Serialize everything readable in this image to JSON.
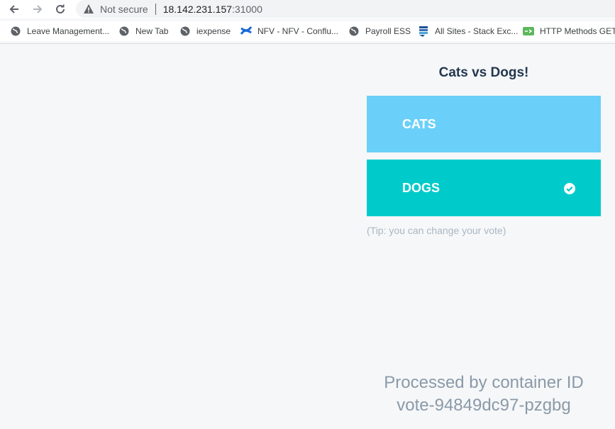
{
  "browser": {
    "security_label": "Not secure",
    "url_host": "18.142.231.157",
    "url_port": ":31000",
    "bookmarks": [
      {
        "label": "Leave Management...",
        "icon": "globe-icon"
      },
      {
        "label": "New Tab",
        "icon": "globe-icon"
      },
      {
        "label": "iexpense",
        "icon": "globe-icon"
      },
      {
        "label": "NFV - NFV - Conflu...",
        "icon": "confluence-icon"
      },
      {
        "label": "Payroll ESS",
        "icon": "globe-icon"
      },
      {
        "label": "All Sites - Stack Exc...",
        "icon": "stackexchange-icon"
      },
      {
        "label": "HTTP Methods GET...",
        "icon": "httpmethods-icon"
      }
    ]
  },
  "page": {
    "title": "Cats vs Dogs!",
    "options": [
      {
        "label": "CATS",
        "selected": false,
        "color": "#6ad0f9"
      },
      {
        "label": "DOGS",
        "selected": true,
        "color": "#00cbca"
      }
    ],
    "tip": "(Tip: you can change your vote)",
    "processed_by": "Processed by container ID",
    "container_id": "vote-94849dc97-pzgbg"
  }
}
